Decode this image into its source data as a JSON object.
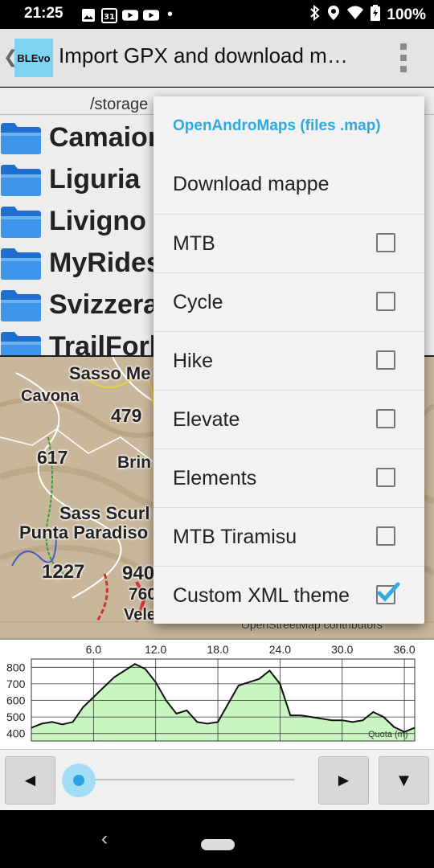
{
  "status_bar": {
    "time": "21:25",
    "calendar_day": "31",
    "battery": "100%",
    "dot": "•"
  },
  "app_bar": {
    "back_glyph": "❮",
    "logo_text": "BLEvo",
    "title": "Import GPX and download m…"
  },
  "browser": {
    "path": "/storage",
    "folders": [
      "Camaiore",
      "Liguria",
      "Livigno",
      "MyRides",
      "Svizzera",
      "TrailForks"
    ]
  },
  "map": {
    "labels": [
      "Sasso Me",
      "Cavona",
      "479",
      "617",
      "Brin",
      "Sass Scurl",
      "Punta Paradiso",
      "1227",
      "940",
      "760",
      "Veleto"
    ],
    "credit": "OpenStreetMap contributors"
  },
  "elevation_chart": {
    "x_ticks": [
      "6.0",
      "12.0",
      "18.0",
      "24.0",
      "30.0",
      "36.0"
    ],
    "y_ticks": [
      "800",
      "700",
      "600",
      "500",
      "400"
    ],
    "axis_label": "Quota (m)",
    "fill_color": "#c8f5c0",
    "chart_data": {
      "type": "area",
      "x": [
        0,
        1,
        2,
        3,
        4,
        5,
        6,
        7,
        8,
        9,
        10,
        11,
        12,
        13,
        14,
        15,
        16,
        17,
        18,
        19,
        20,
        21,
        22,
        23,
        24,
        25,
        26,
        27,
        28,
        29,
        30,
        31,
        32,
        33,
        34,
        35,
        36,
        37
      ],
      "y": [
        435,
        460,
        470,
        455,
        470,
        560,
        620,
        680,
        740,
        780,
        820,
        790,
        710,
        600,
        520,
        540,
        470,
        460,
        470,
        580,
        690,
        710,
        730,
        780,
        700,
        510,
        510,
        500,
        490,
        480,
        480,
        470,
        480,
        530,
        500,
        440,
        410,
        435
      ],
      "xlim": [
        0,
        37
      ],
      "ylim": [
        355,
        850
      ]
    }
  },
  "controls": {
    "prev_label": "◄",
    "next_label": "►",
    "dropdown_label": "▼",
    "slider_value": 0
  },
  "menu": {
    "header": "OpenAndroMaps (files .map)",
    "download_label": "Download mappe",
    "themes": [
      {
        "label": "MTB",
        "checked": false
      },
      {
        "label": "Cycle",
        "checked": false
      },
      {
        "label": "Hike",
        "checked": false
      },
      {
        "label": "Elevate",
        "checked": false
      },
      {
        "label": "Elements",
        "checked": false
      },
      {
        "label": "MTB Tiramisu",
        "checked": false
      },
      {
        "label": "Custom XML theme",
        "checked": true
      }
    ],
    "accent_color": "#2fa9e0"
  },
  "nav": {
    "back_glyph": "‹"
  }
}
